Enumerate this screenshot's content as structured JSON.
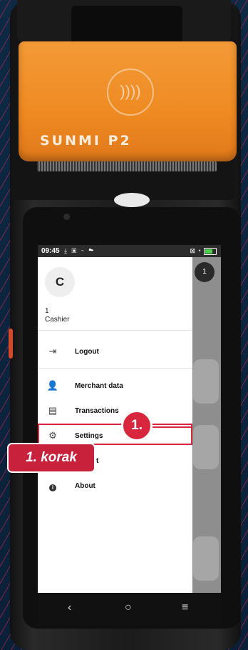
{
  "device": {
    "brand": "SUNMI P2",
    "nfc_symbol": "))))"
  },
  "statusbar": {
    "time": "09:45",
    "icons": "⤓ ▣ ⌁ ☁",
    "right_icons": "⊠ ◔"
  },
  "background_app": {
    "badge": "1"
  },
  "drawer": {
    "avatar_letter": "C",
    "user_number": "1",
    "user_role": "Cashier",
    "items": [
      {
        "label": "Logout",
        "icon": "logout-icon",
        "glyph": "⇥"
      },
      {
        "label": "Merchant data",
        "icon": "merchant-icon",
        "glyph": "👤"
      },
      {
        "label": "Transactions",
        "icon": "transactions-icon",
        "glyph": "▤"
      },
      {
        "label": "Settings",
        "icon": "gear-icon",
        "glyph": "⚙"
      },
      {
        "label": "t",
        "icon": "hidden-item-icon",
        "glyph": ""
      },
      {
        "label": "About",
        "icon": "info-icon",
        "glyph": "i"
      }
    ]
  },
  "navbar": {
    "back": "‹",
    "home": "○",
    "menu": "≡"
  },
  "annotation": {
    "marker": "1.",
    "step_label": "1. korak"
  },
  "colors": {
    "accent": "#d7263d",
    "printer_orange": "#ef8a22"
  }
}
